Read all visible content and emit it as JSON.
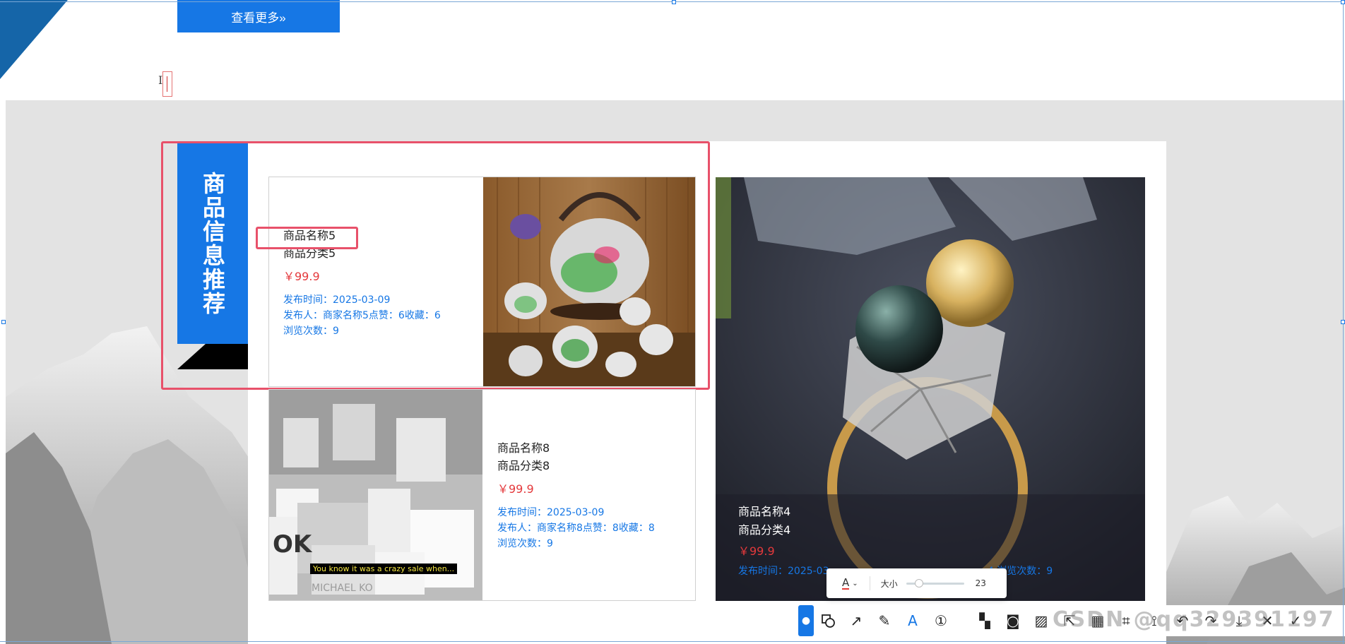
{
  "top": {
    "more_button_label": "查看更多»"
  },
  "section": {
    "title": "商品信息推荐"
  },
  "products": [
    {
      "name": "商品名称5",
      "category": "商品分类5",
      "price": "￥99.9",
      "publish_time": "发布时间：2025-03-09",
      "publisher_line": "发布人：商家名称5点赞：6收藏：6",
      "views": "浏览次数：9"
    },
    {
      "name": "商品名称8",
      "category": "商品分类8",
      "price": "￥99.9",
      "publish_time": "发布时间：2025-03-09",
      "publisher_line": "发布人：商家名称8点赞：8收藏：8",
      "views": "浏览次数：9",
      "image_caption": "You know it was a crazy sale when..."
    },
    {
      "name": "商品名称4",
      "category": "商品分类4",
      "price": "￥99.9",
      "meta_line": "发布时间：2025-03",
      "meta_line_tail": "4  浏览次数：9"
    }
  ],
  "text_popup": {
    "color_label": "A",
    "size_label": "大小",
    "size_value": "23",
    "slider_level": 0.15
  },
  "toolbar": {
    "watermark": "CSDN @qq329391197"
  },
  "colors": {
    "primary": "#1677e5",
    "price": "#e4393c",
    "selection": "#e8516a"
  }
}
